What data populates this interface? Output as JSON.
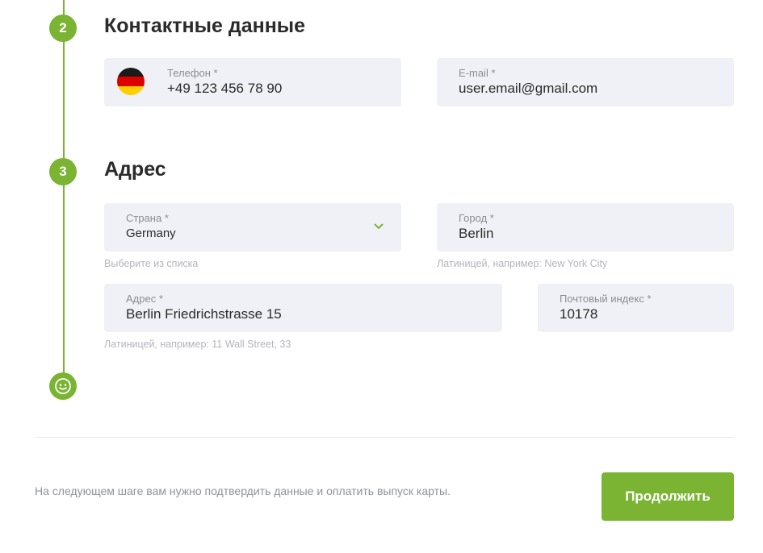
{
  "colors": {
    "accent": "#7ab432",
    "field_bg": "#f0f1f6"
  },
  "steps": {
    "contact": {
      "number": "2",
      "title": "Контактные данные"
    },
    "address": {
      "number": "3",
      "title": "Адрес"
    },
    "final": {
      "icon": "smiley-face-icon"
    }
  },
  "contact": {
    "phone": {
      "label": "Телефон *",
      "value": "+49 123 456 78 90",
      "flag": "germany-flag-icon"
    },
    "email": {
      "label": "E-mail *",
      "value": "user.email@gmail.com"
    }
  },
  "address": {
    "country": {
      "label": "Страна *",
      "value": "Germany",
      "hint": "Выберите из списка",
      "icon": "chevron-down-icon"
    },
    "city": {
      "label": "Город *",
      "value": "Berlin",
      "hint": "Латиницей, например: New York City"
    },
    "street": {
      "label": "Адрес *",
      "value": "Berlin Friedrichstrasse 15",
      "hint": "Латиницей, например: 11 Wall Street, 33"
    },
    "zip": {
      "label": "Почтовый индекс *",
      "value": "10178"
    }
  },
  "footer": {
    "note": "На следующем шаге вам нужно подтвердить данные и оплатить выпуск карты.",
    "continue_label": "Продолжить"
  }
}
